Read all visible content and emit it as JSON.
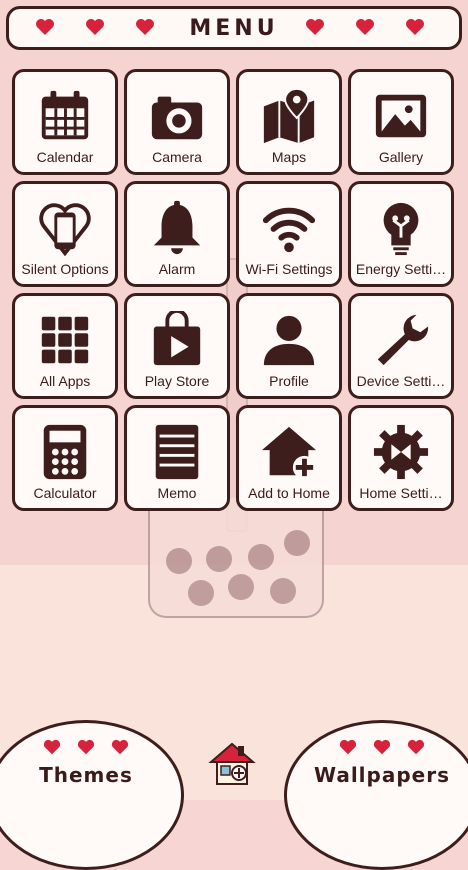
{
  "header": {
    "title": "MENU"
  },
  "apps": [
    {
      "label": "Calendar",
      "icon": "calendar-icon"
    },
    {
      "label": "Camera",
      "icon": "camera-icon"
    },
    {
      "label": "Maps",
      "icon": "map-pin-icon"
    },
    {
      "label": "Gallery",
      "icon": "image-icon"
    },
    {
      "label": "Silent Options",
      "icon": "phone-heart-icon"
    },
    {
      "label": "Alarm",
      "icon": "bell-icon"
    },
    {
      "label": "Wi-Fi Settings",
      "icon": "wifi-icon"
    },
    {
      "label": "Energy Setti…",
      "icon": "lightbulb-icon"
    },
    {
      "label": "All Apps",
      "icon": "grid-icon"
    },
    {
      "label": "Play Store",
      "icon": "store-bag-play-icon"
    },
    {
      "label": "Profile",
      "icon": "person-icon"
    },
    {
      "label": "Device Setti…",
      "icon": "wrench-icon"
    },
    {
      "label": "Calculator",
      "icon": "calculator-icon"
    },
    {
      "label": "Memo",
      "icon": "notepad-icon"
    },
    {
      "label": "Add to Home",
      "icon": "home-plus-icon"
    },
    {
      "label": "Home Setti…",
      "icon": "gear-icon"
    }
  ],
  "bottom": {
    "themes_label": "Themes",
    "wallpapers_label": "Wallpapers"
  },
  "colors": {
    "accent": "#d6233b",
    "ink": "#3e1e1c",
    "tile": "#fffaf8",
    "background": "#f4d3d1"
  }
}
